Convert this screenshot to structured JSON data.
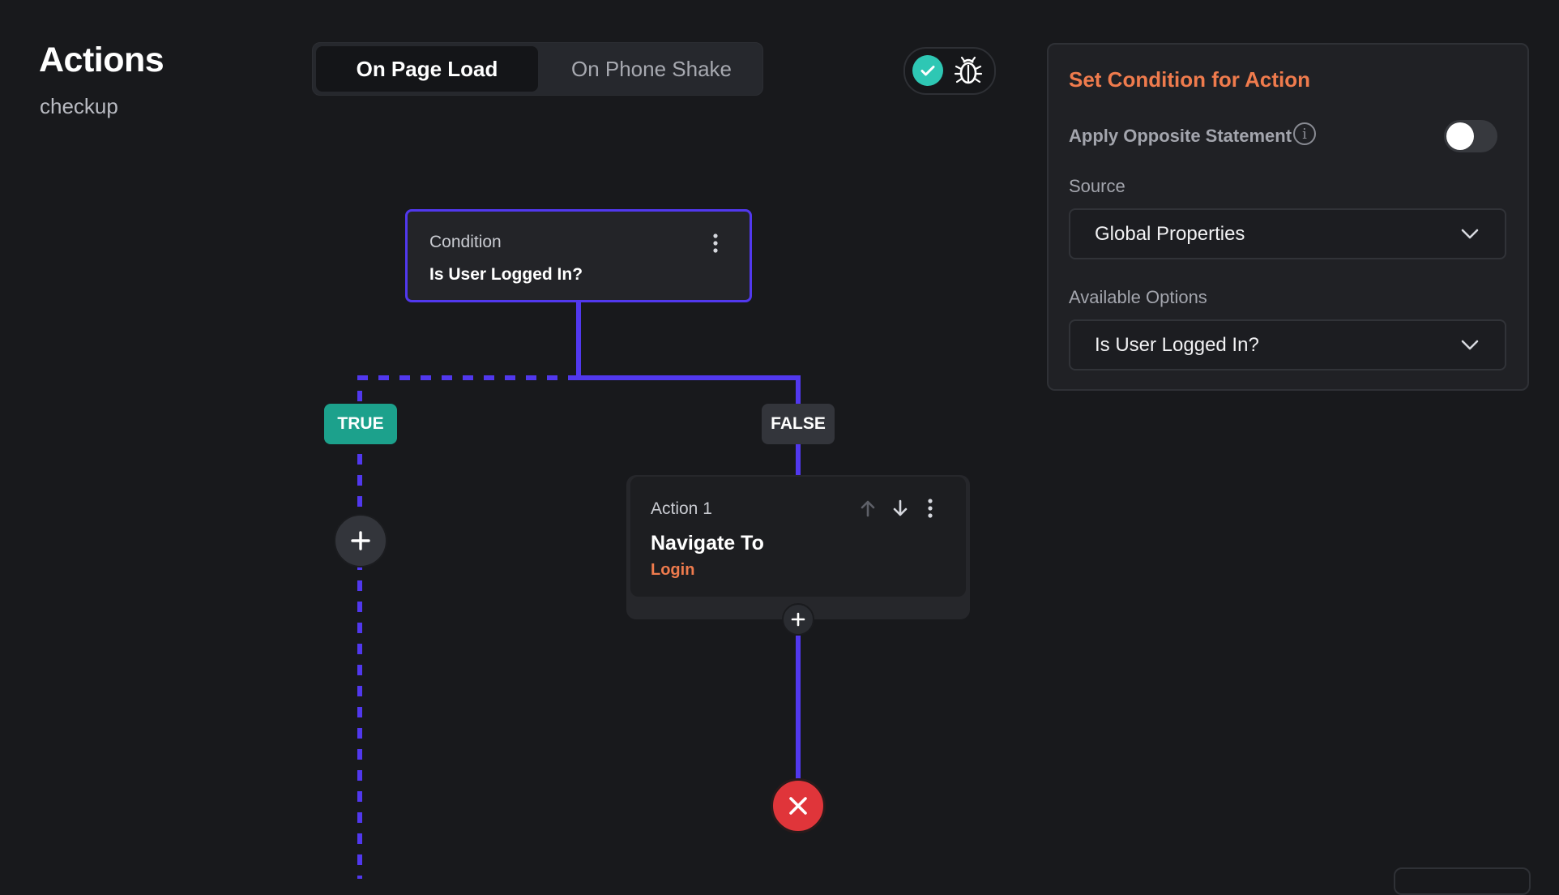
{
  "header": {
    "title": "Actions",
    "subtitle": "checkup"
  },
  "tabs": [
    {
      "label": "On Page Load",
      "active": true
    },
    {
      "label": "On Phone Shake",
      "active": false
    }
  ],
  "toolbar": {
    "icons": [
      "check-icon",
      "bug-icon"
    ],
    "check_color": "#2ec7b4"
  },
  "flow": {
    "condition": {
      "type_label": "Condition",
      "name": "Is User Logged In?"
    },
    "branches": {
      "true_label": "TRUE",
      "false_label": "FALSE"
    },
    "action": {
      "index_label": "Action 1",
      "name": "Navigate To",
      "target": "Login"
    },
    "colors": {
      "connector": "#5138ee",
      "true": "#1ca18c",
      "end": "#e0353a",
      "accent": "#ef7b4d"
    }
  },
  "panel": {
    "title": "Set Condition for Action",
    "opposite_label": "Apply Opposite Statement",
    "opposite_enabled": false,
    "source_label": "Source",
    "source_value": "Global Properties",
    "options_label": "Available Options",
    "options_value": "Is User Logged In?"
  }
}
